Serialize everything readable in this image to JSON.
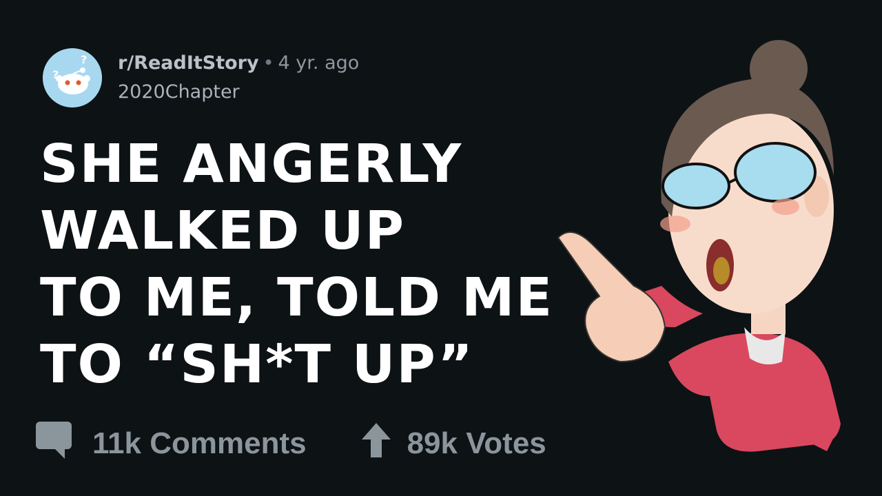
{
  "post": {
    "subreddit": "r/ReadItStory",
    "separator": "•",
    "age": "4 yr. ago",
    "author": "2020Chapter"
  },
  "headline": {
    "lines": [
      "SHE ANGERLY",
      "WALKED UP",
      "TO ME, TOLD ME",
      "TO “SH*T UP”"
    ]
  },
  "stats": {
    "comments_label": "11k Comments",
    "votes_label": "89k Votes",
    "comment_icon": "comment-bubble-icon",
    "vote_icon": "upvote-arrow-icon"
  },
  "colors": {
    "background": "#0d1215",
    "headline": "#ffffff",
    "muted": "#8b959c"
  }
}
